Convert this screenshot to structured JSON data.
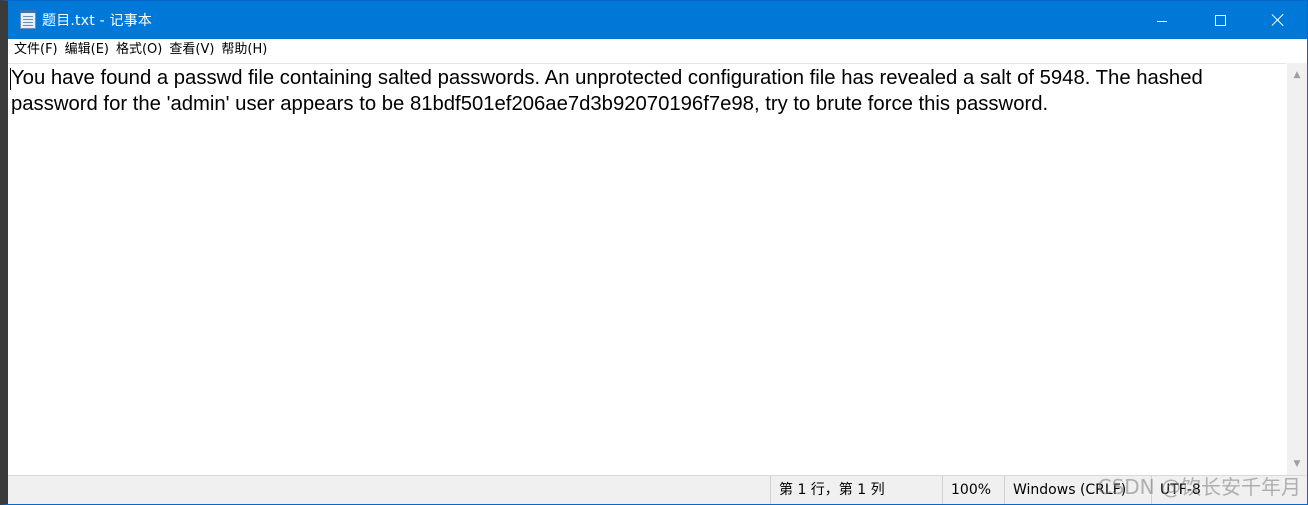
{
  "window": {
    "title": "题目.txt - 记事本"
  },
  "menu": {
    "items": [
      {
        "label": "文件(F)"
      },
      {
        "label": "编辑(E)"
      },
      {
        "label": "格式(O)"
      },
      {
        "label": "查看(V)"
      },
      {
        "label": "帮助(H)"
      }
    ]
  },
  "editor": {
    "content": "You have found a passwd file containing salted passwords. An unprotected configuration file has revealed a salt of 5948. The hashed password for the 'admin' user appears to be 81bdf501ef206ae7d3b92070196f7e98, try to brute force this password."
  },
  "statusbar": {
    "position": "第 1 行，第 1 列",
    "zoom": "100%",
    "line_ending": "Windows (CRLF)",
    "encoding": "UTF-8"
  },
  "watermark": {
    "text": "CSDN @饮长安千年月"
  },
  "colors": {
    "titlebar": "#0078d7",
    "statusbar": "#f0f0f0"
  },
  "icons": {
    "app": "notepad-icon",
    "minimize": "minimize-icon",
    "maximize": "maximize-icon",
    "close": "close-icon"
  }
}
